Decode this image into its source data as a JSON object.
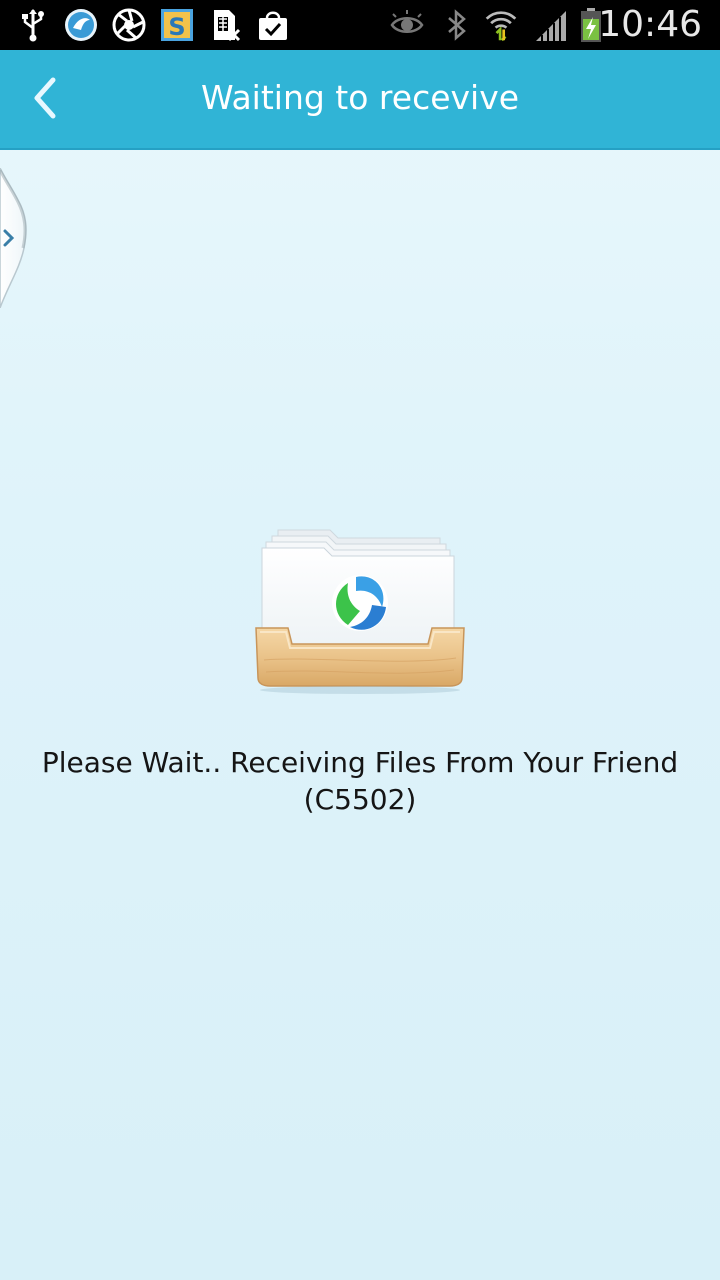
{
  "status_bar": {
    "time": "10:46",
    "left_icons": [
      "usb-icon",
      "app-bird-icon",
      "aperture-icon",
      "s-app-icon",
      "sim-card-icon",
      "shopping-bag-icon"
    ],
    "right_icons": [
      "eye-icon",
      "bluetooth-icon",
      "wifi-icon",
      "signal-icon",
      "battery-charging-icon"
    ]
  },
  "app_bar": {
    "title": "Waiting to recevive",
    "back_icon": "chevron-left-icon",
    "color": "#30b4d6"
  },
  "drawer": {
    "icon": "chevron-right-icon"
  },
  "main": {
    "illustration": "folder-tray-icon",
    "message": "Please Wait.. Receiving Files From Your Friend (C5502)"
  }
}
